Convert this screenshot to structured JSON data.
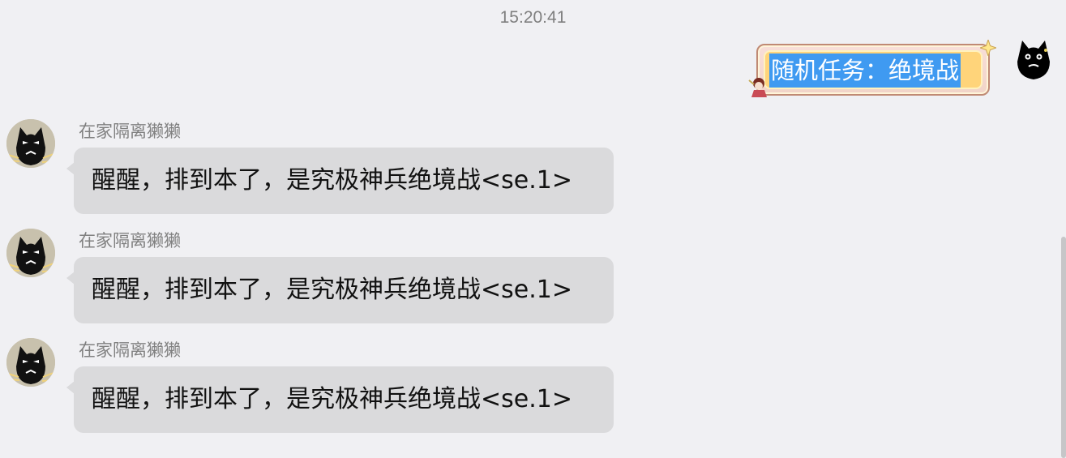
{
  "timestamp": "15:20:41",
  "outgoing": {
    "text": "随机任务：绝境战"
  },
  "messages": [
    {
      "sender": "在家隔离獭獭",
      "text": "醒醒，排到本了，是究极神兵绝境战<se.1>"
    },
    {
      "sender": "在家隔离獭獭",
      "text": "醒醒，排到本了，是究极神兵绝境战<se.1>"
    },
    {
      "sender": "在家隔离獭獭",
      "text": "醒醒，排到本了，是究极神兵绝境战<se.1>"
    }
  ],
  "colors": {
    "background": "#f0f0f3",
    "incoming_bubble": "#dadadc",
    "selection": "#3f9af1",
    "fancy_bubble": "#ffd47a"
  },
  "icons": {
    "self_avatar": "black-cat-avatar",
    "contact_avatar": "black-cat-avatar",
    "bubble_decoration": "chibi-sticker-icon"
  }
}
